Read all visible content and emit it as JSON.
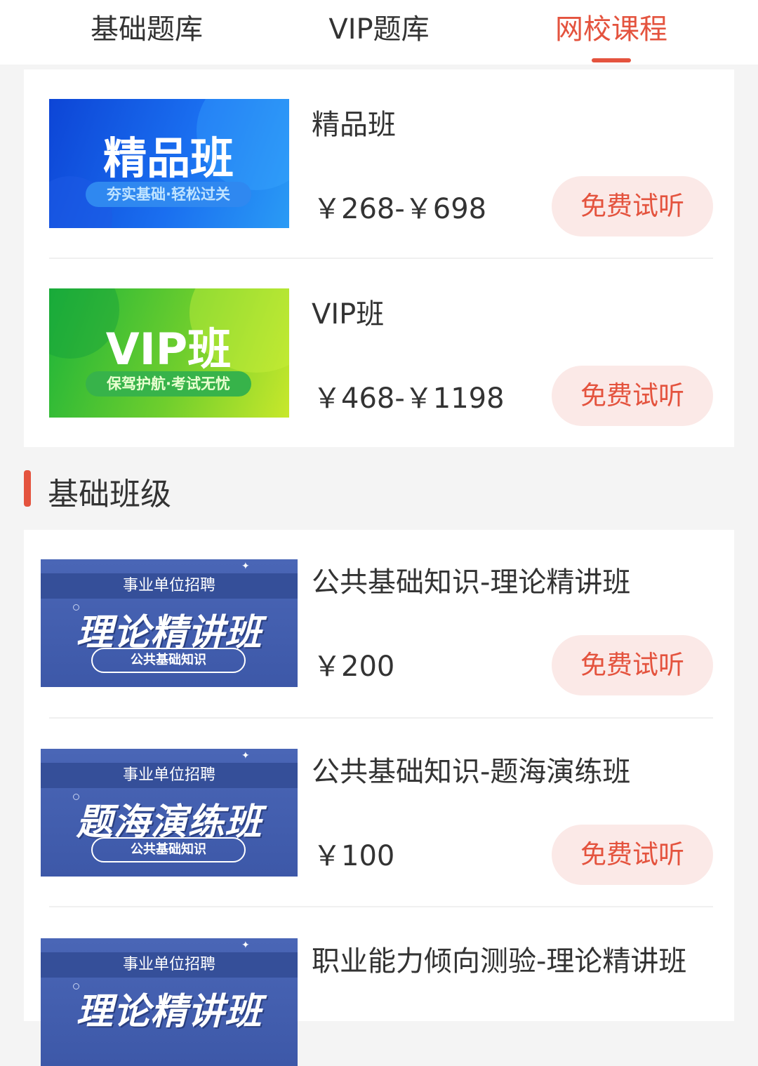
{
  "tabs": [
    {
      "label": "基础题库",
      "active": false
    },
    {
      "label": "VIP题库",
      "active": false
    },
    {
      "label": "网校课程",
      "active": true
    }
  ],
  "accent_color": "#e4533e",
  "featured_courses": [
    {
      "name": "精品班",
      "price": "￥268-￥698",
      "button_label": "免费试听",
      "banner": {
        "title": "精品班",
        "subtitle": "夯实基础·轻松过关"
      }
    },
    {
      "name": "VIP班",
      "price": "￥468-￥1198",
      "button_label": "免费试听",
      "banner": {
        "title": "VIP班",
        "subtitle": "保驾护航·考试无忧"
      }
    }
  ],
  "section": {
    "title": "基础班级"
  },
  "basic_courses": [
    {
      "name": "公共基础知识-理论精讲班",
      "price": "￥200",
      "button_label": "免费试听",
      "banner": {
        "top": "事业单位招聘",
        "main": "理论精讲班",
        "tag": "公共基础知识"
      }
    },
    {
      "name": "公共基础知识-题海演练班",
      "price": "￥100",
      "button_label": "免费试听",
      "banner": {
        "top": "事业单位招聘",
        "main": "题海演练班",
        "tag": "公共基础知识"
      }
    },
    {
      "name": "职业能力倾向测验-理论精讲班",
      "banner": {
        "top": "事业单位招聘",
        "main": "理论精讲班"
      }
    }
  ]
}
